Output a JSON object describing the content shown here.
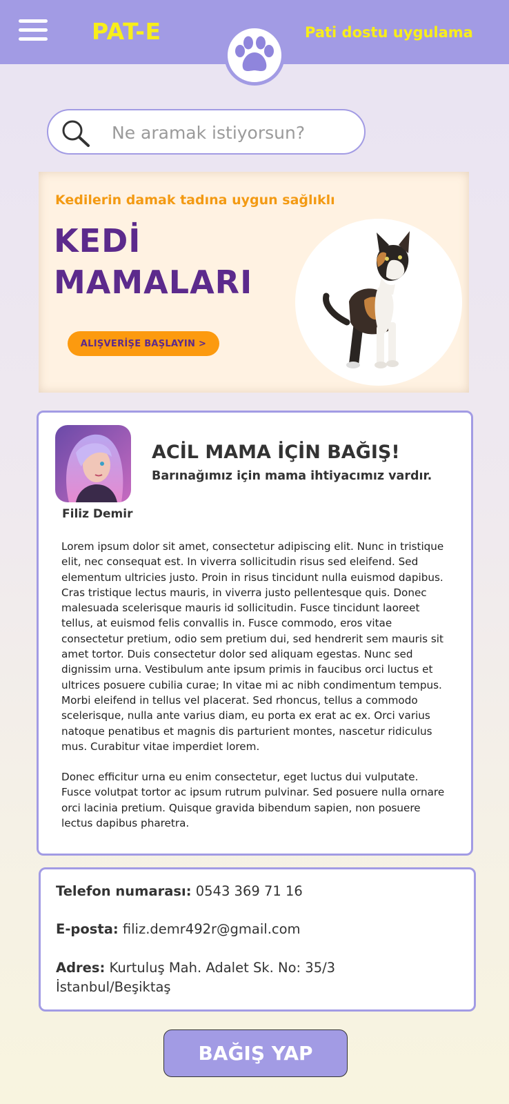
{
  "header": {
    "brand": "PAT-E",
    "tagline": "Pati dostu uygulama",
    "brand_color": "#f8ee1a",
    "bar_color": "#a29be4",
    "menu_icon": "hamburger-menu-icon",
    "logo_icon": "paw-icon"
  },
  "search": {
    "placeholder": "Ne aramak istiyorsun?",
    "icon": "search-icon"
  },
  "banner": {
    "subtitle": "Kedilerin damak tadına uygun sağlıklı",
    "title_line1": "KEDİ",
    "title_line2": "MAMALARI",
    "cta_label": "ALIŞVERİŞE BAŞLAYIN >",
    "accent_color": "#fc9a0f",
    "title_color": "#5c2a8c"
  },
  "post": {
    "author": "Filiz Demir",
    "title": "ACİL MAMA İÇİN BAĞIŞ!",
    "subtitle": "Barınağımız için mama ihtiyacımız vardır.",
    "paragraph1": "Lorem ipsum dolor sit amet, consectetur adipiscing elit. Nunc in tristique elit, nec consequat est. In viverra sollicitudin risus sed eleifend. Sed elementum ultricies justo. Proin in risus tincidunt nulla euismod dapibus. Cras tristique lectus mauris, in viverra justo pellentesque quis. Donec malesuada scelerisque mauris id sollicitudin. Fusce tincidunt laoreet tellus, at euismod felis convallis in. Fusce commodo, eros vitae consectetur pretium, odio sem pretium dui, sed hendrerit sem mauris sit amet tortor. Duis consectetur dolor sed aliquam egestas. Nunc sed dignissim urna. Vestibulum ante ipsum primis in faucibus orci luctus et ultrices posuere cubilia curae; In vitae mi ac nibh condimentum tempus. Morbi eleifend in tellus vel placerat. Sed rhoncus, tellus a commodo scelerisque, nulla ante varius diam, eu porta ex erat ac ex. Orci varius natoque penatibus et magnis dis parturient montes, nascetur ridiculus mus. Curabitur vitae imperdiet lorem.",
    "paragraph2": "Donec efficitur urna eu enim consectetur, eget luctus dui vulputate. Fusce volutpat tortor ac ipsum rutrum pulvinar. Sed posuere nulla ornare orci lacinia pretium. Quisque gravida bibendum sapien, non posuere lectus dapibus pharetra."
  },
  "contact": {
    "phone_label": "Telefon numarası:",
    "phone_value": "0543 369 71 16",
    "email_label": "E-posta:",
    "email_value": "filiz.demr492r@gmail.com",
    "address_label": "Adres:",
    "address_line1": "Kurtuluş Mah. Adalet Sk.  No: 35/3",
    "address_line2": "İstanbul/Beşiktaş"
  },
  "donate": {
    "label": "BAĞIŞ YAP"
  }
}
